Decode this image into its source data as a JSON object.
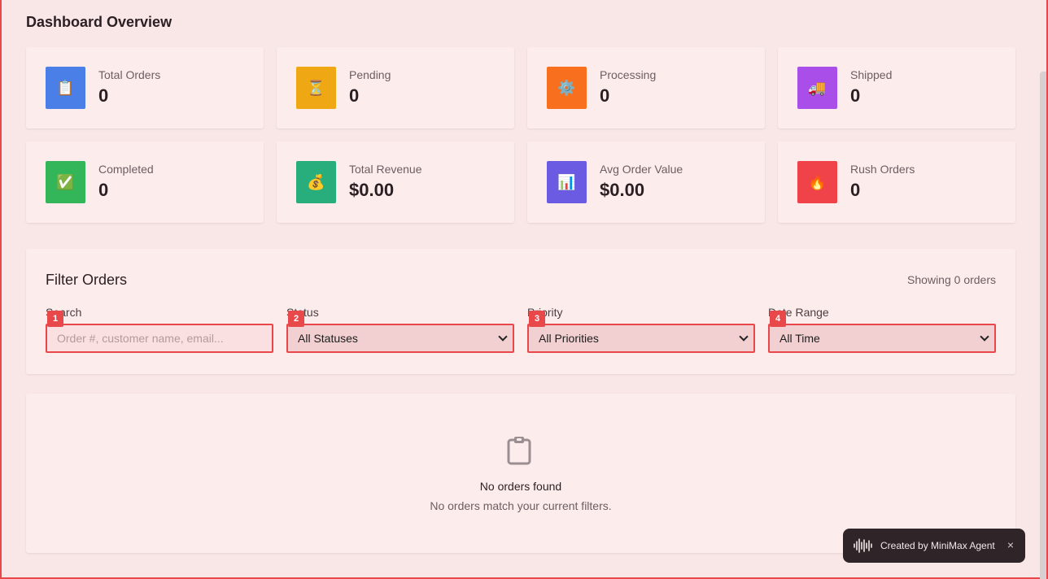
{
  "page": {
    "title": "Dashboard Overview"
  },
  "stats": [
    {
      "label": "Total Orders",
      "value": "0",
      "icon": "clipboard-icon",
      "glyph": "📋",
      "color": "#4a7fe8"
    },
    {
      "label": "Pending",
      "value": "0",
      "icon": "hourglass-icon",
      "glyph": "⏳",
      "color": "#efa713"
    },
    {
      "label": "Processing",
      "value": "0",
      "icon": "gear-icon",
      "glyph": "⚙️",
      "color": "#f86f1d"
    },
    {
      "label": "Shipped",
      "value": "0",
      "icon": "truck-icon",
      "glyph": "🚚",
      "color": "#a94ee8"
    },
    {
      "label": "Completed",
      "value": "0",
      "icon": "check-icon",
      "glyph": "✅",
      "color": "#33b55a"
    },
    {
      "label": "Total Revenue",
      "value": "$0.00",
      "icon": "money-bag-icon",
      "glyph": "💰",
      "color": "#28ae7c"
    },
    {
      "label": "Avg Order Value",
      "value": "$0.00",
      "icon": "bar-chart-icon",
      "glyph": "📊",
      "color": "#6b5be2"
    },
    {
      "label": "Rush Orders",
      "value": "0",
      "icon": "fire-icon",
      "glyph": "🔥",
      "color": "#ef4249"
    }
  ],
  "filters": {
    "title": "Filter Orders",
    "showing": "Showing 0 orders",
    "search": {
      "label": "Search",
      "placeholder": "Order #, customer name, email...",
      "badge": "1"
    },
    "status": {
      "label": "Status",
      "selected": "All Statuses",
      "badge": "2"
    },
    "priority": {
      "label": "Priority",
      "selected": "All Priorities",
      "badge": "3"
    },
    "date_range": {
      "label": "Date Range",
      "selected": "All Time",
      "badge": "4"
    }
  },
  "empty": {
    "icon": "clipboard-icon",
    "title": "No orders found",
    "subtitle": "No orders match your current filters."
  },
  "toast": {
    "text": "Created by MiniMax Agent",
    "close": "×",
    "icon": "sound-wave-icon"
  }
}
